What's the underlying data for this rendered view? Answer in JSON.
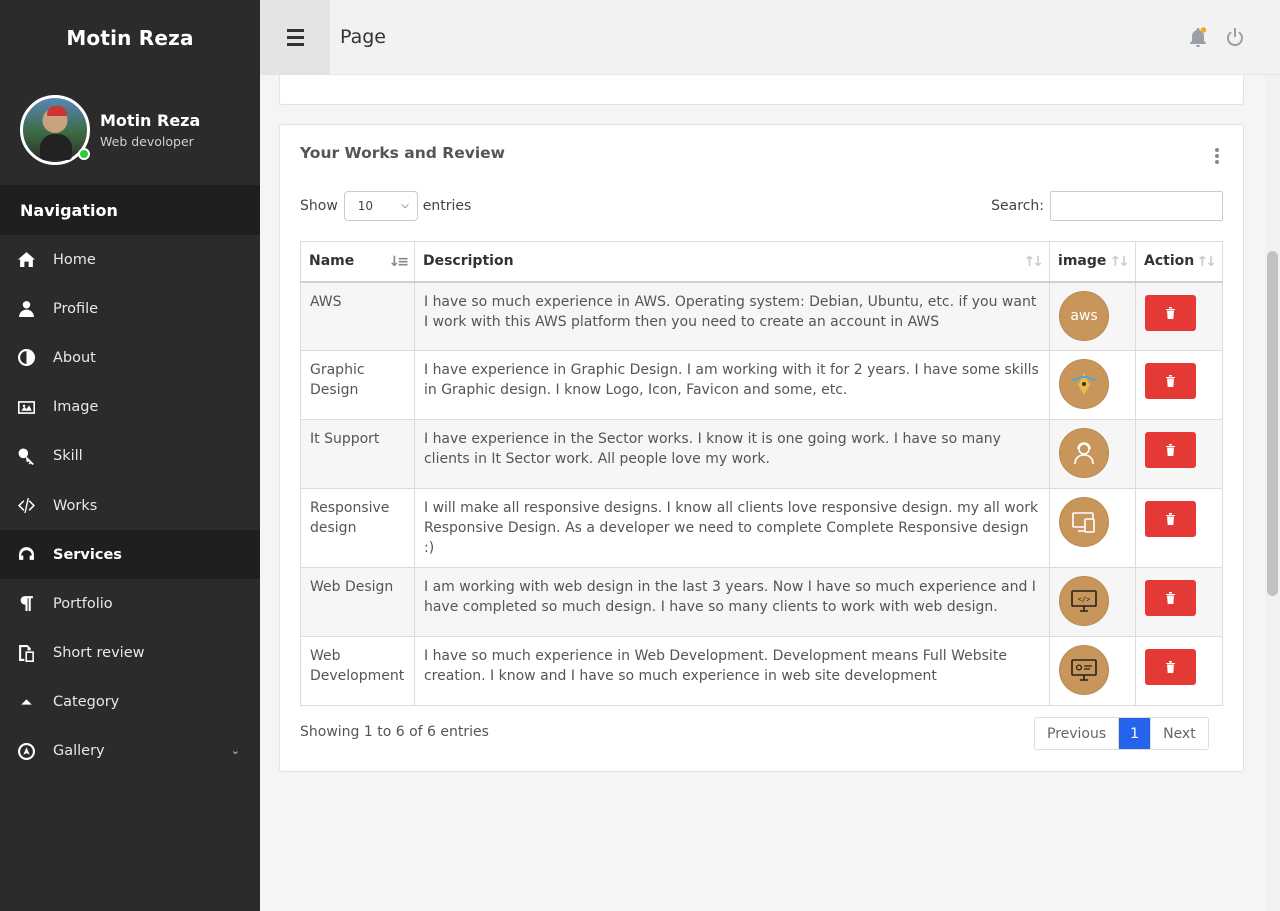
{
  "sidebar": {
    "brand": "Motin Reza",
    "profile": {
      "name": "Motin Reza",
      "role": "Web devoloper"
    },
    "nav_heading": "Navigation",
    "items": [
      {
        "label": "Home",
        "icon": "home-icon"
      },
      {
        "label": "Profile",
        "icon": "user-icon"
      },
      {
        "label": "About",
        "icon": "half-circle-icon"
      },
      {
        "label": "Image",
        "icon": "image-icon"
      },
      {
        "label": "Skill",
        "icon": "key-icon"
      },
      {
        "label": "Works",
        "icon": "code-icon"
      },
      {
        "label": "Services",
        "icon": "headphones-icon",
        "active": true
      },
      {
        "label": "Portfolio",
        "icon": "paragraph-icon"
      },
      {
        "label": "Short review",
        "icon": "copy-icon"
      },
      {
        "label": "Category",
        "icon": "caret-up-icon"
      },
      {
        "label": "Gallery",
        "icon": "compass-icon",
        "has_children": true
      }
    ]
  },
  "topbar": {
    "title": "Page"
  },
  "card": {
    "title": "Your Works and Review",
    "show_label": "Show",
    "entries_label": "entries",
    "page_size": "10",
    "search_label": "Search:",
    "columns": [
      "Name",
      "Description",
      "image",
      "Action"
    ],
    "rows": [
      {
        "name": "AWS",
        "description": "I have so much experience in AWS. Operating system: Debian, Ubuntu, etc. if you want I work with this AWS platform then you need to create an account in AWS",
        "image": "aws-icon",
        "image_text": "aws"
      },
      {
        "name": "Graphic Design",
        "description": "I have experience in Graphic Design. I am working with it for 2 years. I have some skills in Graphic design. I know Logo, Icon, Favicon and some, etc.",
        "image": "pen-tool-icon"
      },
      {
        "name": "It Support",
        "description": "I have experience in the Sector works. I know it is one going work. I have so many clients in It Sector work. All people love my work.",
        "image": "support-person-icon"
      },
      {
        "name": "Responsive design",
        "description": "I will make all responsive designs. I know all clients love responsive design. my all work Responsive Design. As a developer we need to complete Complete Responsive design :)",
        "image": "responsive-devices-icon"
      },
      {
        "name": "Web Design",
        "description": "I am working with web design in the last 3 years. Now I have so much experience and I have completed so much design. I have so many clients to work with web design.",
        "image": "monitor-code-icon",
        "image_text": "</>"
      },
      {
        "name": "Web Development",
        "description": "I have so much experience in Web Development. Development means Full Website creation. I know and I have so much experience in web site development",
        "image": "monitor-dev-icon"
      }
    ],
    "info": "Showing 1 to 6 of 6 entries",
    "pager": {
      "previous": "Previous",
      "current": "1",
      "next": "Next"
    }
  },
  "colors": {
    "sidebar_bg": "#2b2b2b",
    "delete": "#e53935",
    "pager_active": "#2563eb",
    "image_circle": "#c8955a",
    "notification": "#f5a623"
  }
}
